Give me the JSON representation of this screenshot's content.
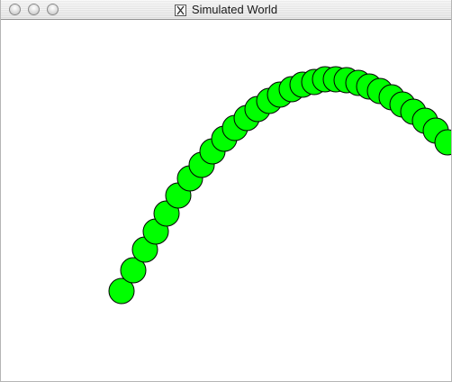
{
  "window": {
    "title": "Simulated World",
    "app_icon": "x11-icon"
  },
  "titlebar": {
    "buttons": [
      {
        "name": "close",
        "icon": "close-icon"
      },
      {
        "name": "minimize",
        "icon": "minimize-icon"
      },
      {
        "name": "zoom",
        "icon": "zoom-icon"
      }
    ]
  },
  "world": {
    "background_color": "#ffffff",
    "ball_fill": "#00ff00",
    "ball_stroke": "#000000",
    "ball_count": 30
  }
}
